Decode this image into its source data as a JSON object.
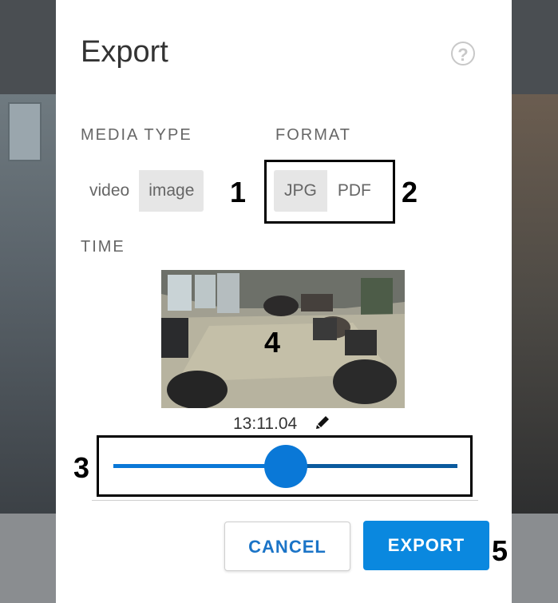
{
  "dialog": {
    "title": "Export",
    "help_icon": "help-icon",
    "help_glyph": "?"
  },
  "media_type": {
    "label": "MEDIA TYPE",
    "options": [
      "video",
      "image"
    ],
    "selected": "image"
  },
  "format": {
    "label": "FORMAT",
    "options": [
      "JPG",
      "PDF"
    ],
    "selected": "JPG"
  },
  "time": {
    "label": "TIME",
    "timestamp": "13:11.04",
    "edit_icon": "pencil-icon",
    "slider_position": 0.51
  },
  "buttons": {
    "cancel": "CANCEL",
    "export": "EXPORT"
  },
  "annotations": {
    "m1": "1",
    "m2": "2",
    "m3": "3",
    "m4": "4",
    "m5": "5"
  },
  "colors": {
    "accent": "#0a78d7",
    "button_primary": "#0a88df",
    "button_text": "#1b74c7"
  }
}
